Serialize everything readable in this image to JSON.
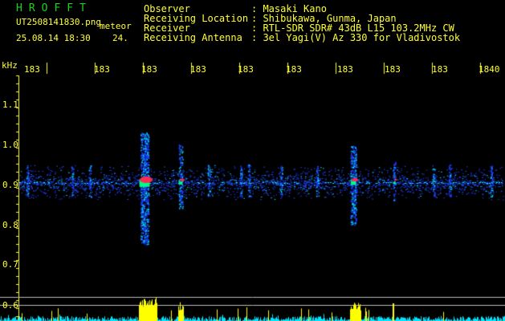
{
  "app": {
    "logo": "HROFFT",
    "filename": "UT2508141830.png",
    "tag": "meteor",
    "datetime": "25.08.14 18:30",
    "count": "24."
  },
  "info": {
    "observer_label": "Observer",
    "observer_value": ": Masaki Kano",
    "location_label": "Receiving Location",
    "location_value": ": Shibukawa, Gunma, Japan",
    "receiver_label": "Receiver",
    "receiver_value": ": RTL-SDR SDR# 43dB L15 103.2MHz CW",
    "antenna_label": "Receiving Antenna",
    "antenna_value": ": 3el Yagi(V) Az 330 for Vladivostok"
  },
  "axes": {
    "y_unit": "kHz",
    "y_ticks": [
      "1.1",
      "1.0",
      "0.9",
      "0.8",
      "0.7",
      "0.6"
    ],
    "x_ticks": [
      "183",
      "183",
      "183",
      "183",
      "183",
      "183",
      "183",
      "183",
      "183",
      "1840"
    ]
  },
  "colors": {
    "label_green": "#19d419",
    "text_yellow": "#ffff33",
    "trace_yellow": "#ffff00",
    "noise_blue": "#1c3cff",
    "noise_cyan": "#00e5ff",
    "echo_red": "#ff2a50"
  }
}
